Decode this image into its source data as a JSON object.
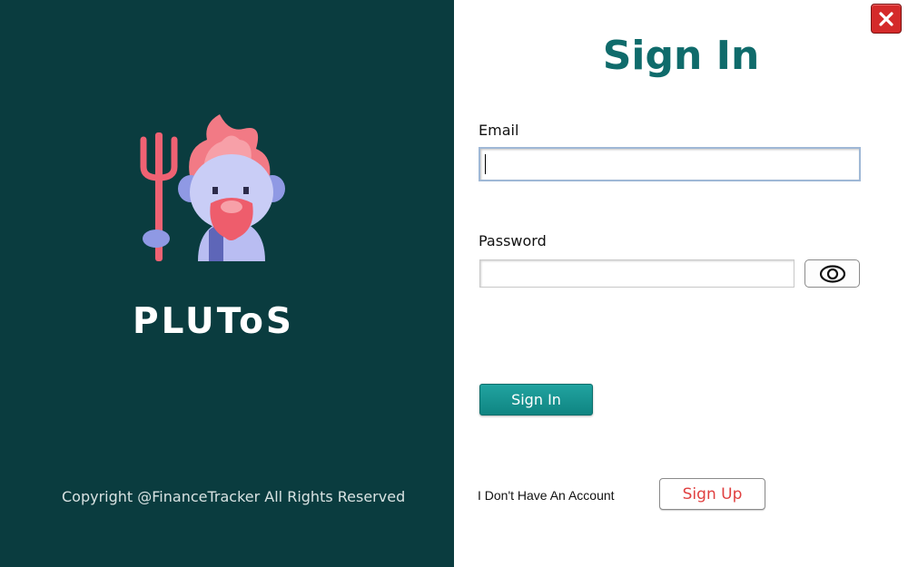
{
  "brand": {
    "name": "PLUToS",
    "copyright": "Copyright @FinanceTracker All Rights Reserved",
    "logo_icon": "pluto-devil-icon"
  },
  "form": {
    "title": "Sign In",
    "email_label": "Email",
    "email_value": "",
    "password_label": "Password",
    "password_value": "",
    "show_password_icon": "eye-icon",
    "signin_label": "Sign In",
    "no_account_text": "I Don't Have An Account",
    "signup_label": "Sign Up"
  },
  "window": {
    "close_icon": "close-icon"
  },
  "colors": {
    "sidebar_bg": "#0a3c3f",
    "title": "#0f6b6b",
    "primary_button": "#1a9896",
    "signup_text": "#e04040",
    "close_button": "#d42a2a"
  }
}
